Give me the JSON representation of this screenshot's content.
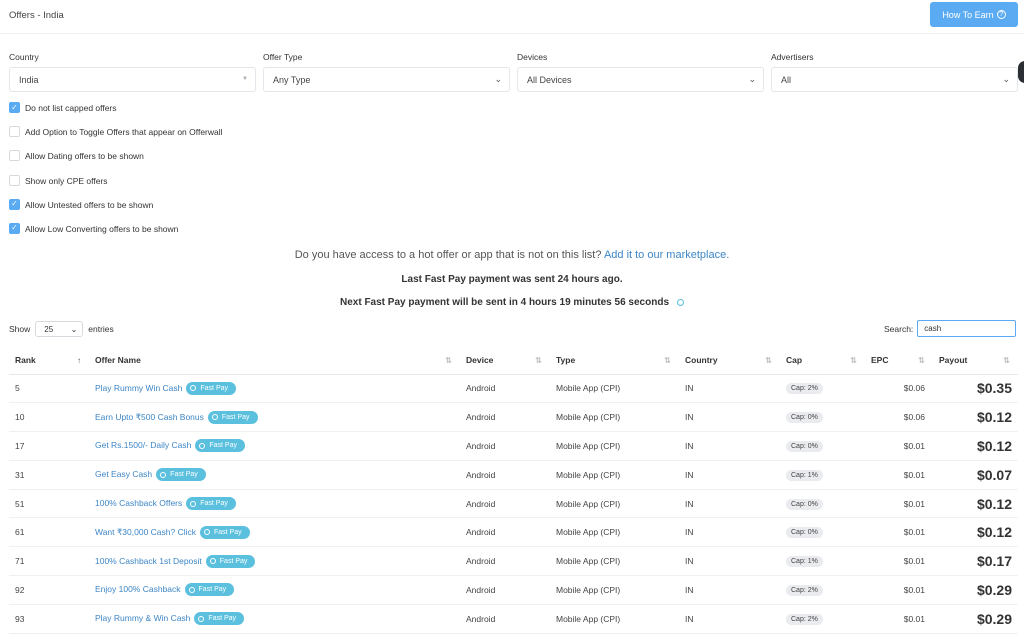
{
  "header": {
    "title": "Offers - India",
    "how_to_earn": "How To Earn"
  },
  "filters": {
    "country": {
      "label": "Country",
      "value": "India"
    },
    "offer_type": {
      "label": "Offer Type",
      "value": "Any Type"
    },
    "devices": {
      "label": "Devices",
      "value": "All Devices"
    },
    "advertisers": {
      "label": "Advertisers",
      "value": "All"
    }
  },
  "options": [
    {
      "label": "Do not list capped offers",
      "checked": true
    },
    {
      "label": "Add Option to Toggle Offers that appear on Offerwall",
      "checked": false
    },
    {
      "label": "Allow Dating offers to be shown",
      "checked": false
    },
    {
      "label": "Show only CPE offers",
      "checked": false
    },
    {
      "label": "Allow Untested offers to be shown",
      "checked": true
    },
    {
      "label": "Allow Low Converting offers to be shown",
      "checked": true
    }
  ],
  "notices": {
    "hot_offer_text": "Do you have access to a hot offer or app that is not on this list?",
    "hot_offer_link": "Add it to our marketplace.",
    "last_payment": "Last Fast Pay payment was sent 24 hours ago.",
    "next_payment": "Next Fast Pay payment will be sent in 4 hours 19 minutes 56 seconds"
  },
  "table_controls": {
    "show_label": "Show",
    "page_size": "25",
    "entries_label": "entries",
    "search_label": "Search:",
    "search_value": "cash"
  },
  "columns": [
    "Rank",
    "Offer Name",
    "Device",
    "Type",
    "Country",
    "Cap",
    "EPC",
    "Payout"
  ],
  "fast_pay_label": "Fast Pay",
  "rows": [
    {
      "rank": "5",
      "name": "Play Rummy Win Cash",
      "device": "Android",
      "type": "Mobile App (CPI)",
      "country": "IN",
      "cap": "Cap: 2%",
      "epc": "$0.06",
      "payout": "$0.35"
    },
    {
      "rank": "10",
      "name": "Earn Upto ₹500 Cash Bonus",
      "device": "Android",
      "type": "Mobile App (CPI)",
      "country": "IN",
      "cap": "Cap: 0%",
      "epc": "$0.06",
      "payout": "$0.12"
    },
    {
      "rank": "17",
      "name": "Get Rs.1500/- Daily Cash",
      "device": "Android",
      "type": "Mobile App (CPI)",
      "country": "IN",
      "cap": "Cap: 0%",
      "epc": "$0.01",
      "payout": "$0.12"
    },
    {
      "rank": "31",
      "name": "Get Easy Cash",
      "device": "Android",
      "type": "Mobile App (CPI)",
      "country": "IN",
      "cap": "Cap: 1%",
      "epc": "$0.01",
      "payout": "$0.07"
    },
    {
      "rank": "51",
      "name": "100% Cashback Offers",
      "device": "Android",
      "type": "Mobile App (CPI)",
      "country": "IN",
      "cap": "Cap: 0%",
      "epc": "$0.01",
      "payout": "$0.12"
    },
    {
      "rank": "61",
      "name": "Want ₹30,000 Cash? Click",
      "device": "Android",
      "type": "Mobile App (CPI)",
      "country": "IN",
      "cap": "Cap: 0%",
      "epc": "$0.01",
      "payout": "$0.12"
    },
    {
      "rank": "71",
      "name": "100% Cashback 1st Deposit",
      "device": "Android",
      "type": "Mobile App (CPI)",
      "country": "IN",
      "cap": "Cap: 1%",
      "epc": "$0.01",
      "payout": "$0.17"
    },
    {
      "rank": "92",
      "name": "Enjoy 100% Cashback",
      "device": "Android",
      "type": "Mobile App (CPI)",
      "country": "IN",
      "cap": "Cap: 2%",
      "epc": "$0.01",
      "payout": "$0.29"
    },
    {
      "rank": "93",
      "name": "Play Rummy & Win Cash",
      "device": "Android",
      "type": "Mobile App (CPI)",
      "country": "IN",
      "cap": "Cap: 2%",
      "epc": "$0.01",
      "payout": "$0.29"
    }
  ],
  "colors": {
    "accent": "#5aabf2",
    "link": "#3d86c6",
    "fast_pay": "#5bc0de"
  }
}
